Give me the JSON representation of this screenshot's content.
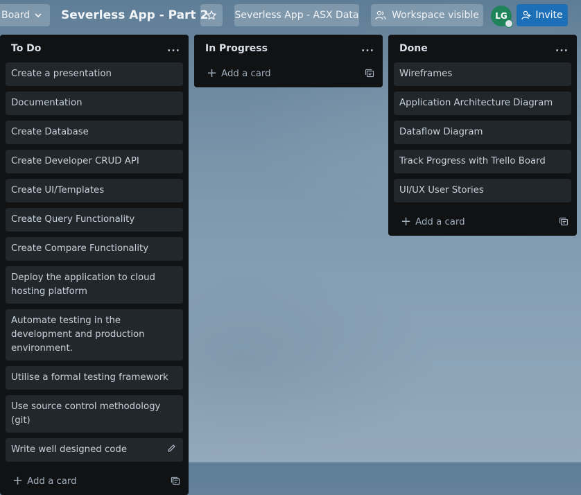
{
  "header": {
    "board_label": "Board",
    "title": "Severless App - Part 2",
    "workspace_label": "Severless App - ASX Data",
    "visibility_label": "Workspace visible",
    "avatar_initials": "LG",
    "invite_label": "Invite"
  },
  "lists": [
    {
      "title": "To Do",
      "more": "...",
      "cards": [
        "Create a presentation",
        "Documentation",
        "Create Database",
        "Create Developer CRUD API",
        "Create UI/Templates",
        "Create Query Functionality",
        "Create Compare Functionality",
        "Deploy the application to cloud hosting platform",
        "Automate testing in the development and production environment.",
        "Utilise a formal testing framework",
        "Use source control methodology (git)",
        "Write well designed code"
      ],
      "add_label": "Add a card"
    },
    {
      "title": "In Progress",
      "more": "...",
      "cards": [],
      "add_label": "Add a card"
    },
    {
      "title": "Done",
      "more": "...",
      "cards": [
        "Wireframes",
        "Application Architecture Diagram",
        "Dataflow Diagram",
        "Track Progress with Trello Board",
        "UI/UX User Stories"
      ],
      "add_label": "Add a card"
    }
  ]
}
